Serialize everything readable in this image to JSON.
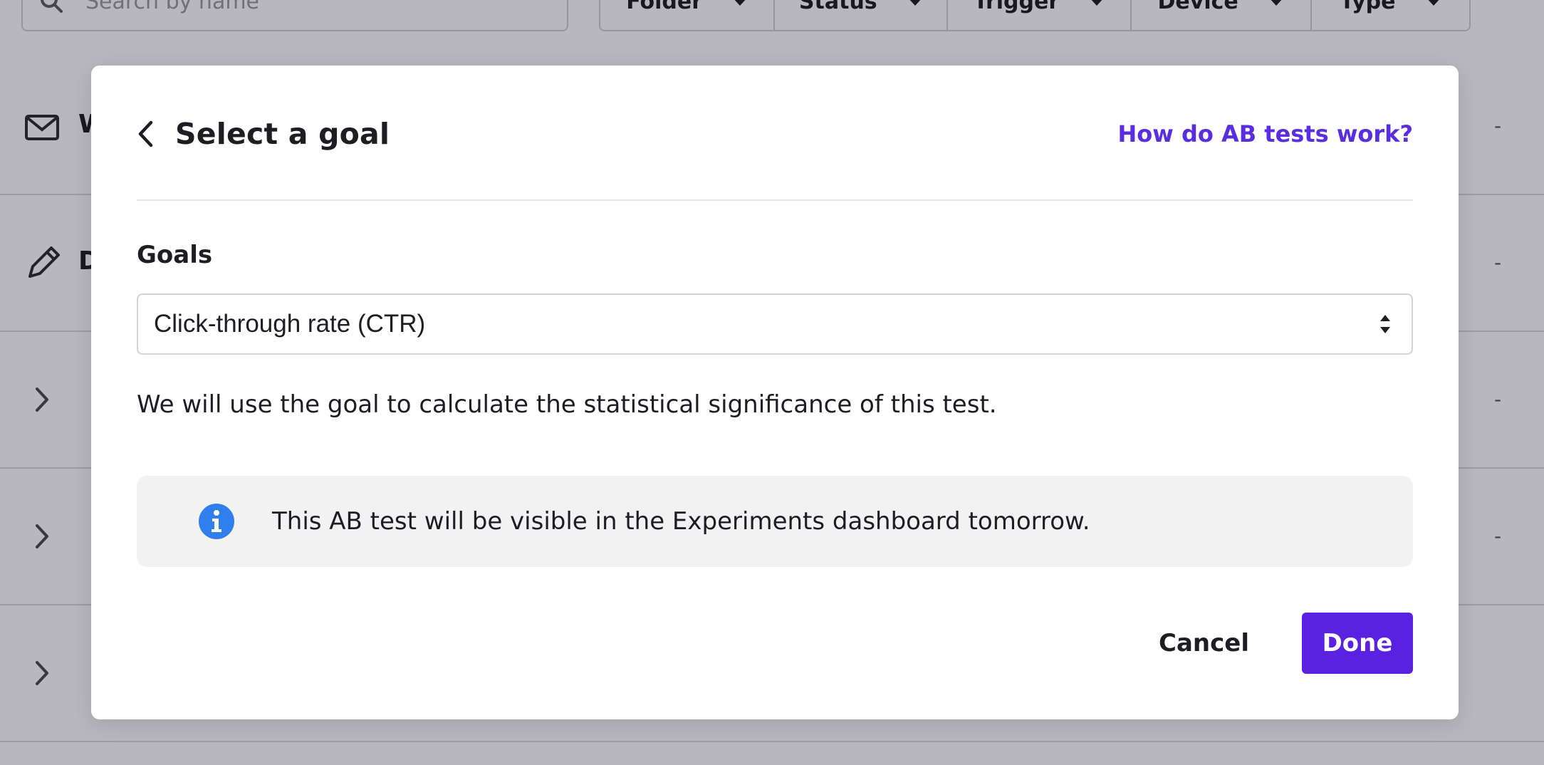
{
  "background": {
    "search": {
      "placeholder": "Search by name",
      "icon": "search-icon"
    },
    "filters": [
      {
        "label": "Folder"
      },
      {
        "label": "Status"
      },
      {
        "label": "Trigger"
      },
      {
        "label": "Device"
      },
      {
        "label": "Type"
      }
    ],
    "rows": [
      {
        "icon": "envelope-icon",
        "name_fragment": "W",
        "value": "-"
      },
      {
        "icon": "pencil-icon",
        "name_fragment": "D",
        "value": "-"
      },
      {
        "icon": "chevron-right-icon",
        "name_fragment": "",
        "value": "-"
      },
      {
        "icon": "chevron-right-icon",
        "name_fragment": "",
        "value": "-"
      },
      {
        "icon": "chevron-right-icon",
        "name_fragment": "",
        "value": ""
      }
    ]
  },
  "modal": {
    "title": "Select a goal",
    "help_link": "How do AB tests work?",
    "goals_label": "Goals",
    "goal_select": {
      "value": "Click-through rate (CTR)"
    },
    "helper_text": "We will use the goal to calculate the statistical significance of this test.",
    "info": {
      "icon": "info-icon",
      "text": "This AB test will be visible in the Experiments dashboard tomorrow."
    },
    "buttons": {
      "cancel": "Cancel",
      "done": "Done"
    }
  },
  "colors": {
    "accent": "#5b21e0",
    "link": "#5b2de0",
    "info_icon": "#2f80ed",
    "overlay": "rgba(16,16,36,0.3)"
  }
}
